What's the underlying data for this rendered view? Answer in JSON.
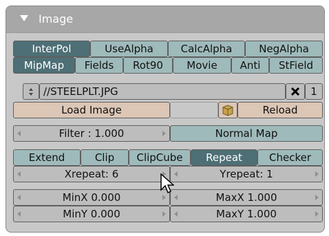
{
  "panel": {
    "title": "Image"
  },
  "row1": [
    "InterPol",
    "UseAlpha",
    "CalcAlpha",
    "NegAlpha"
  ],
  "row2": [
    "MipMap",
    "Fields",
    "Rot90",
    "Movie",
    "Anti",
    "StField"
  ],
  "image": {
    "path": "//STEELPLT.JPG",
    "users": "1",
    "spin_icon": "up-down-arrows-icon",
    "close_icon": "x-icon"
  },
  "load": {
    "load_label": "Load Image",
    "reload_label": "Reload",
    "reload_icon": "box-icon"
  },
  "filter": {
    "label": "Filter : 1.000",
    "normal_map": "Normal Map"
  },
  "extend_modes": [
    "Extend",
    "Clip",
    "ClipCube",
    "Repeat",
    "Checker"
  ],
  "repeat": {
    "x": "Xrepeat: 6",
    "y": "Yrepeat: 1"
  },
  "bounds": {
    "minx": "MinX 0.000",
    "maxx": "MaxX 1.000",
    "miny": "MinY 0.000",
    "maxy": "MaxY 1.000"
  },
  "colors": {
    "toggle_on": "#4d6f75",
    "toggle_off": "#9fbaba",
    "load": "#dcc6b6",
    "header": "#a7a7a7"
  }
}
